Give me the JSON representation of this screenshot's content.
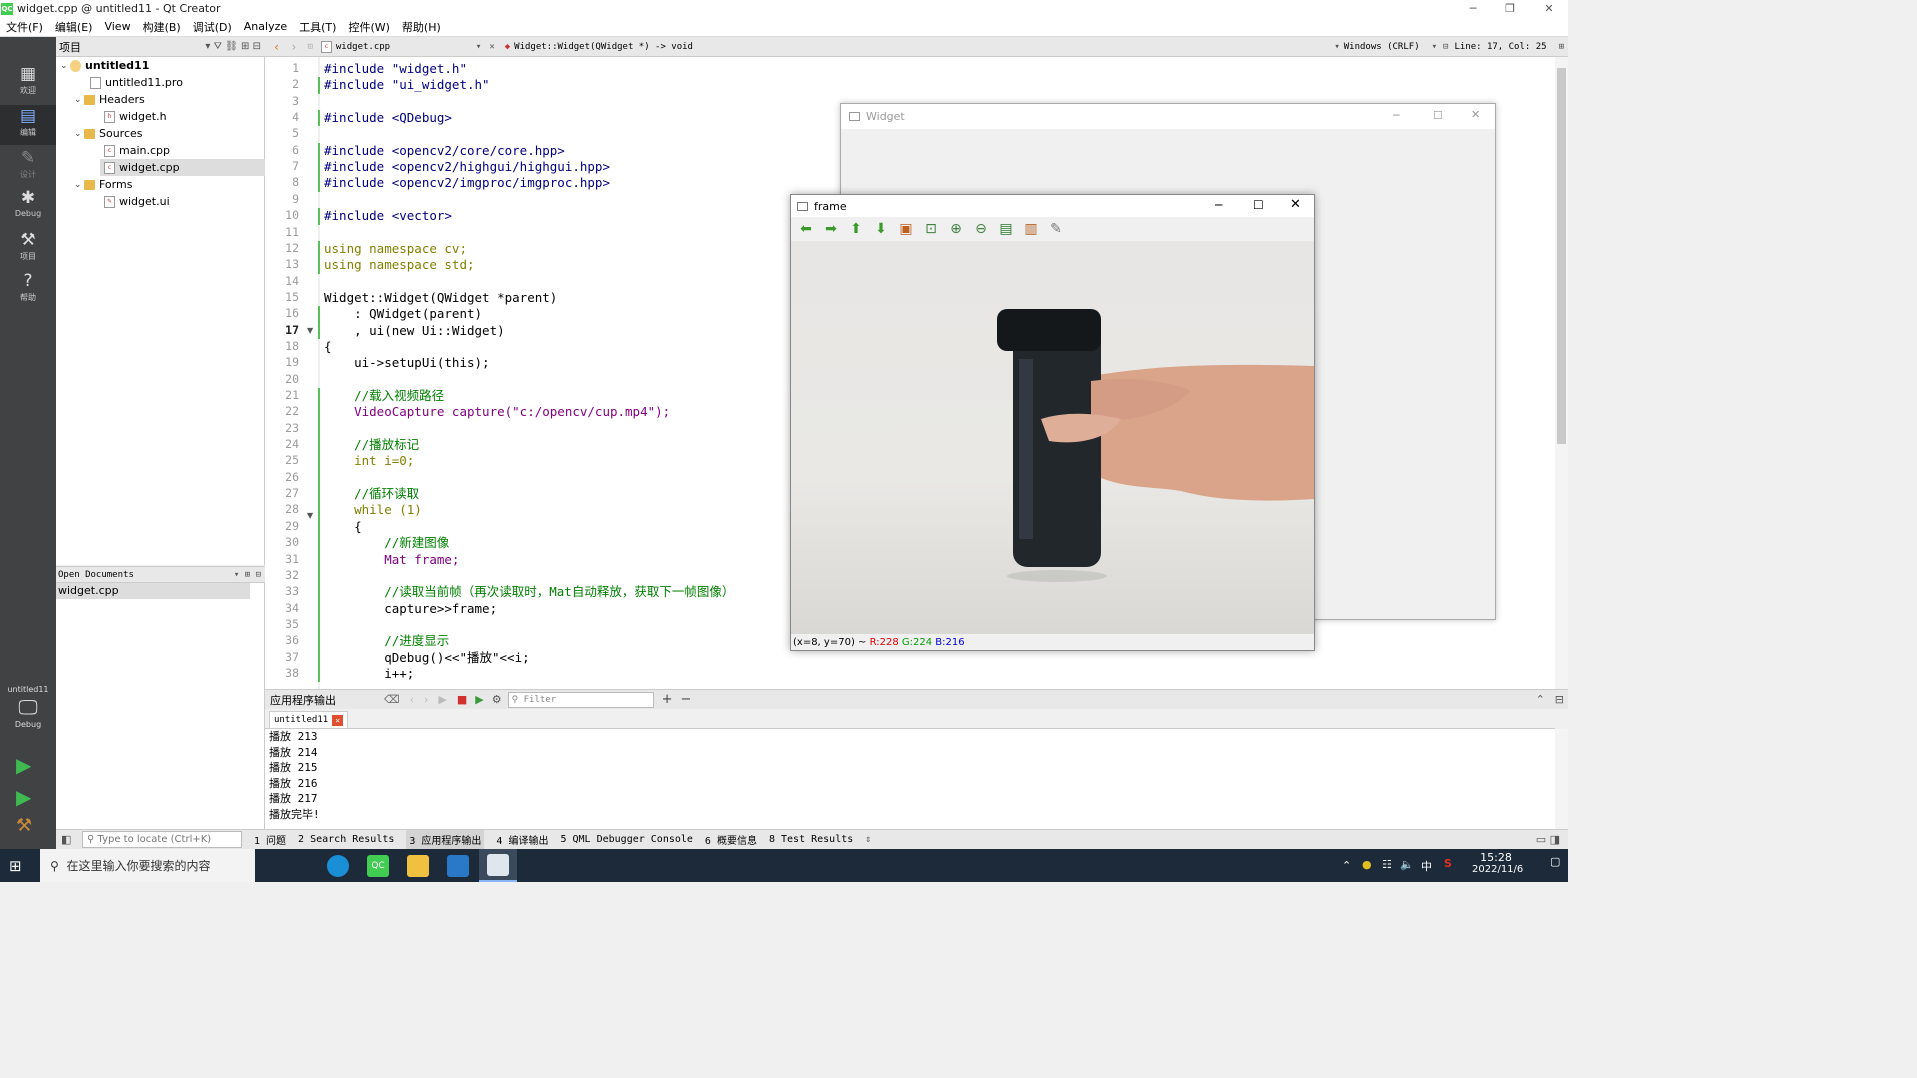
{
  "window": {
    "title": "widget.cpp @ untitled11 - Qt Creator",
    "app_badge": "QC"
  },
  "menu": [
    "文件(F)",
    "编辑(E)",
    "View",
    "构建(B)",
    "调试(D)",
    "Analyze",
    "工具(T)",
    "控件(W)",
    "帮助(H)"
  ],
  "modes": [
    {
      "label": "欢迎",
      "icon": "grid-icon"
    },
    {
      "label": "编辑",
      "icon": "edit-icon"
    },
    {
      "label": "设计",
      "icon": "design-icon"
    },
    {
      "label": "Debug",
      "icon": "bug-icon"
    },
    {
      "label": "项目",
      "icon": "wrench-icon"
    },
    {
      "label": "帮助",
      "icon": "help-icon"
    }
  ],
  "kit": {
    "project": "untitled11",
    "config": "Debug"
  },
  "project_pane": {
    "title": "项目",
    "tree": [
      {
        "label": "untitled11",
        "kind": "project",
        "bold": true
      },
      {
        "label": "untitled11.pro",
        "kind": "file"
      },
      {
        "label": "Headers",
        "kind": "folder"
      },
      {
        "label": "widget.h",
        "kind": "file"
      },
      {
        "label": "Sources",
        "kind": "folder"
      },
      {
        "label": "main.cpp",
        "kind": "file"
      },
      {
        "label": "widget.cpp",
        "kind": "file",
        "selected": true
      },
      {
        "label": "Forms",
        "kind": "folder"
      },
      {
        "label": "widget.ui",
        "kind": "file"
      }
    ]
  },
  "open_documents": {
    "title": "Open Documents",
    "items": [
      "widget.cpp"
    ]
  },
  "editor": {
    "file": "widget.cpp",
    "symbol": "Widget::Widget(QWidget *) -> void",
    "encoding": "Windows (CRLF)",
    "position": "Line: 17, Col: 25",
    "current_line": "17",
    "lines": [
      "#include \"widget.h\"",
      "#include \"ui_widget.h\"",
      "",
      "#include <QDebug>",
      "",
      "#include <opencv2/core/core.hpp>",
      "#include <opencv2/highgui/highgui.hpp>",
      "#include <opencv2/imgproc/imgproc.hpp>",
      "",
      "#include <vector>",
      "",
      "using namespace cv;",
      "using namespace std;",
      "",
      "Widget::Widget(QWidget *parent)",
      "    : QWidget(parent)",
      "    , ui(new Ui::Widget)",
      "{",
      "    ui->setupUi(this);",
      "",
      "    //载入视频路径",
      "    VideoCapture capture(\"c:/opencv/cup.mp4\");",
      "",
      "    //播放标记",
      "    int i=0;",
      "",
      "    //循环读取",
      "    while (1)",
      "    {",
      "        //新建图像",
      "        Mat frame;",
      "",
      "        //读取当前帧（再次读取时，Mat自动释放，获取下一帧图像）",
      "        capture>>frame;",
      "",
      "        //进度显示",
      "        qDebug()<<\"播放\"<<i;",
      "        i++;"
    ]
  },
  "widget_window": {
    "title": "Widget"
  },
  "frame_window": {
    "title": "frame",
    "status_prefix": "(x=8, y=70) ~",
    "r": "R:228",
    "g": "G:224",
    "b": "B:216"
  },
  "output": {
    "title": "应用程序输出",
    "tab": "untitled11",
    "filter_placeholder": "Filter",
    "lines": [
      "播放 213",
      "播放 214",
      "播放 215",
      "播放 216",
      "播放 217",
      "播放完毕!"
    ]
  },
  "status": {
    "locator_placeholder": "Type to locate (Ctrl+K)",
    "panes": [
      "1 问题",
      "2 Search Results",
      "3 应用程序输出",
      "4 编译输出",
      "5 QML Debugger Console",
      "6 概要信息",
      "8 Test Results"
    ]
  },
  "taskbar": {
    "search_placeholder": "在这里输入你要搜索的内容",
    "time": "15:28",
    "date": "2022/11/6",
    "ime": "中"
  },
  "colors": {
    "keyword": "#808000",
    "type": "#800080",
    "string": "#008000",
    "comment": "#008000",
    "preproc": "#000080",
    "r": "#e00000",
    "g": "#00a000",
    "b": "#0000e0"
  }
}
